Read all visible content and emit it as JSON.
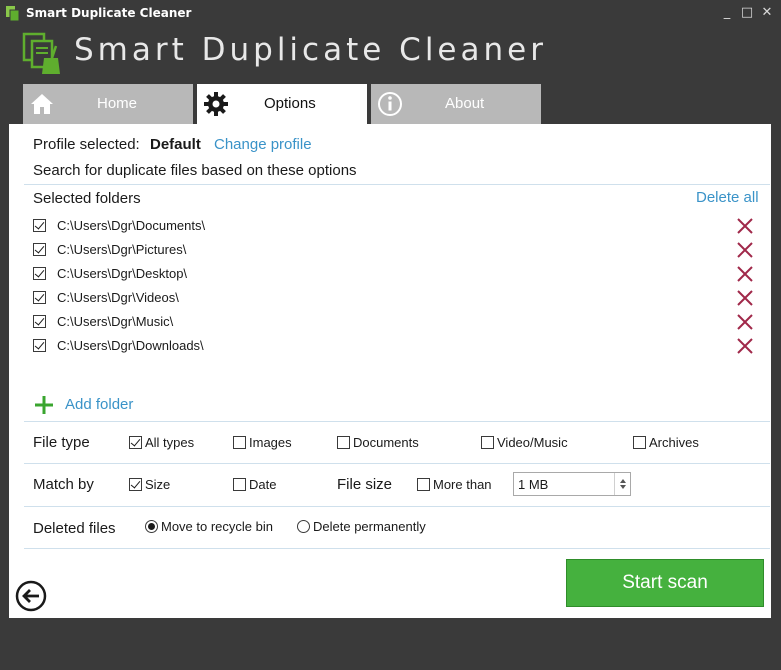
{
  "window": {
    "title": "Smart Duplicate Cleaner",
    "minimize": "_",
    "maximize": "□",
    "close": "✕"
  },
  "header": {
    "title": "Smart Duplicate Cleaner"
  },
  "tabs": [
    {
      "label": "Home",
      "icon": "home-icon"
    },
    {
      "label": "Options",
      "icon": "gear-icon"
    },
    {
      "label": "About",
      "icon": "info-icon"
    }
  ],
  "profile": {
    "label": "Profile selected:",
    "name": "Default",
    "change_link": "Change profile"
  },
  "search_desc": "Search for duplicate files based on these options",
  "folders": {
    "heading": "Selected folders",
    "delete_all": "Delete all",
    "items": [
      "C:\\Users\\Dgr\\Documents\\",
      "C:\\Users\\Dgr\\Pictures\\",
      "C:\\Users\\Dgr\\Desktop\\",
      "C:\\Users\\Dgr\\Videos\\",
      "C:\\Users\\Dgr\\Music\\",
      "C:\\Users\\Dgr\\Downloads\\"
    ],
    "add_folder": "Add folder"
  },
  "file_type": {
    "label": "File type",
    "options": [
      {
        "label": "All types",
        "checked": true
      },
      {
        "label": "Images",
        "checked": false
      },
      {
        "label": "Documents",
        "checked": false
      },
      {
        "label": "Video/Music",
        "checked": false
      },
      {
        "label": "Archives",
        "checked": false
      }
    ]
  },
  "match_by": {
    "label": "Match by",
    "size": {
      "label": "Size",
      "checked": true
    },
    "date": {
      "label": "Date",
      "checked": false
    },
    "file_size_label": "File size",
    "more_than": {
      "label": "More than",
      "checked": false
    },
    "size_value": "1 MB"
  },
  "deleted_files": {
    "label": "Deleted files",
    "options": [
      {
        "label": "Move to recycle bin",
        "selected": true
      },
      {
        "label": "Delete permanently",
        "selected": false
      }
    ]
  },
  "actions": {
    "start_scan": "Start scan"
  },
  "colors": {
    "accent_green": "#45b13e",
    "link_blue": "#3a93c8",
    "delete_red": "#a0284a",
    "chrome": "#3a3a3a",
    "tab_inactive": "#b8b8b8"
  }
}
